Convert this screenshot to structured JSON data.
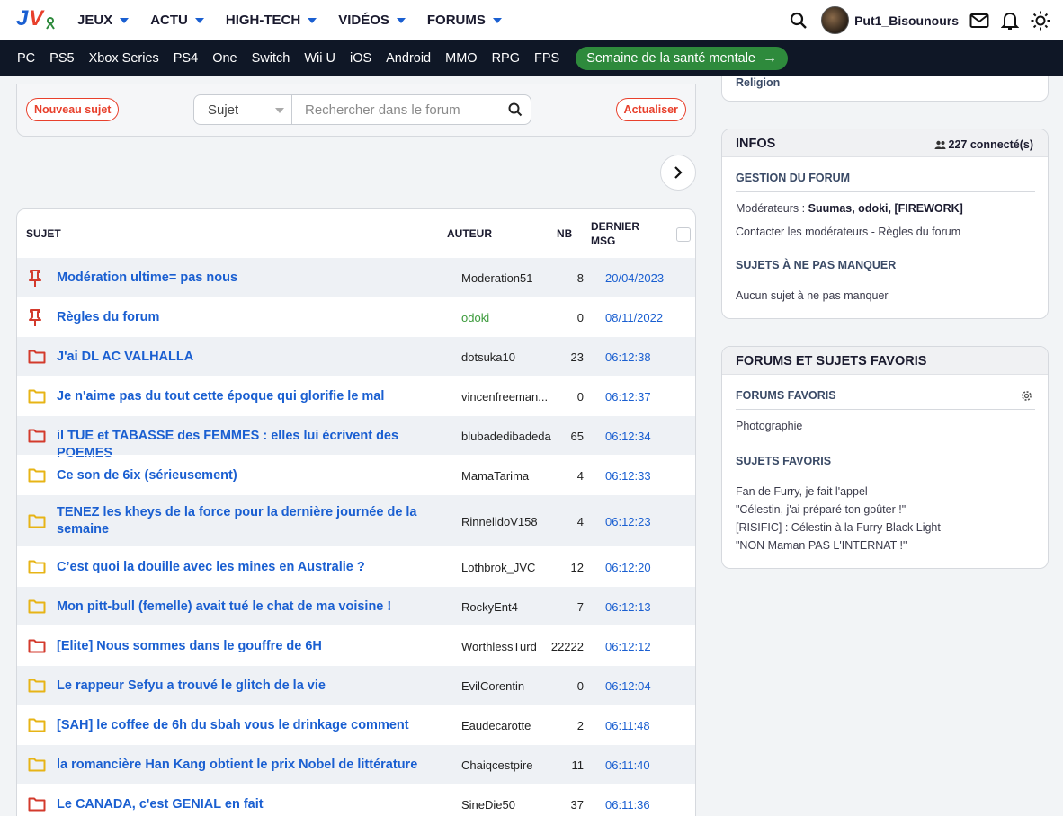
{
  "header": {
    "nav": [
      "JEUX",
      "ACTU",
      "HIGH-TECH",
      "VIDÉOS",
      "FORUMS"
    ],
    "username": "Put1_Bisounours"
  },
  "platforms": [
    "PC",
    "PS5",
    "Xbox Series",
    "PS4",
    "One",
    "Switch",
    "Wii U",
    "iOS",
    "Android",
    "MMO",
    "RPG",
    "FPS"
  ],
  "promo": "Semaine de la santé mentale",
  "search": {
    "new_topic": "Nouveau sujet",
    "select_value": "Sujet",
    "placeholder": "Rechercher dans le forum",
    "refresh": "Actualiser"
  },
  "table": {
    "col_subject": "SUJET",
    "col_author": "AUTEUR",
    "col_nb": "NB",
    "col_last_1": "DERNIER",
    "col_last_2": "MSG",
    "rows": [
      {
        "icon": "pin",
        "title": "Modération ultime= pas nous",
        "author": "Moderation51",
        "nb": "8",
        "last": "20/04/2023"
      },
      {
        "icon": "pin",
        "title": "Règles du forum",
        "author": "odoki",
        "nb": "0",
        "last": "08/11/2022"
      },
      {
        "icon": "folder-red",
        "title": "J'ai DL AC VALHALLA",
        "author": "dotsuka10",
        "nb": "23",
        "last": "06:12:38"
      },
      {
        "icon": "folder-yellow",
        "title": "Je n'aime pas du tout cette époque qui glorifie le mal",
        "author": "vincenfreeman...",
        "nb": "0",
        "last": "06:12:37"
      },
      {
        "icon": "folder-red",
        "title": "il TUE et TABASSE des FEMMES : elles lui écrivent des POEMES",
        "author": "blubadedibadeda",
        "nb": "65",
        "last": "06:12:34"
      },
      {
        "icon": "folder-yellow",
        "title": "Ce son de 6ix (sérieusement)",
        "author": "MamaTarima",
        "nb": "4",
        "last": "06:12:33"
      },
      {
        "icon": "folder-yellow",
        "title": "TENEZ les kheys de la force pour la dernière journée de la semaine",
        "author": "RinnelidoV158",
        "nb": "4",
        "last": "06:12:23"
      },
      {
        "icon": "folder-yellow",
        "title": "C’est quoi la douille avec les mines en Australie ?",
        "author": "Lothbrok_JVC",
        "nb": "12",
        "last": "06:12:20"
      },
      {
        "icon": "folder-yellow",
        "title": "Mon pitt-bull (femelle) avait tué le chat de ma voisine !",
        "author": "RockyEnt4",
        "nb": "7",
        "last": "06:12:13"
      },
      {
        "icon": "folder-red",
        "title": "[Elite] Nous sommes dans le gouffre de 6H",
        "author": "WorthlessTurd",
        "nb": "22222",
        "last": "06:12:12"
      },
      {
        "icon": "folder-yellow",
        "title": "Le rappeur Sefyu a trouvé le glitch de la vie",
        "author": "EvilCorentin",
        "nb": "0",
        "last": "06:12:04"
      },
      {
        "icon": "folder-yellow",
        "title": "[SAH] le coffee de 6h du sbah vous le drinkage comment",
        "author": "Eaudecarotte",
        "nb": "2",
        "last": "06:11:48"
      },
      {
        "icon": "folder-yellow",
        "title": "la romancière Han Kang obtient le prix Nobel de littérature",
        "author": "Chaiqcestpire",
        "nb": "11",
        "last": "06:11:40"
      },
      {
        "icon": "folder-red",
        "title": "Le CANADA, c'est GENIAL en fait",
        "author": "SineDie50",
        "nb": "37",
        "last": "06:11:36"
      }
    ]
  },
  "sidebar": {
    "top_item": "Religion",
    "infos": {
      "title": "INFOS",
      "connected": "227 connecté(s)",
      "gestion": "GESTION DU FORUM",
      "moderators_label": "Modérateurs :",
      "moderators": "Suumas, odoki, [FIREWORK]",
      "contact": "Contacter les modérateurs - Règles du forum",
      "must_see_title": "SUJETS À NE PAS MANQUER",
      "must_see_text": "Aucun sujet à ne pas manquer"
    },
    "favorites": {
      "title": "FORUMS ET SUJETS FAVORIS",
      "forums_title": "FORUMS FAVORIS",
      "forums": [
        "Photographie"
      ],
      "topics_title": "SUJETS FAVORIS",
      "topics": [
        "Fan de Furry, je fait l'appel",
        "\"Célestin, j'ai préparé ton goûter !\"",
        "[RISIFIC] : Célestin à la Furry Black Light",
        "\"NON Maman PAS L'INTERNAT !\""
      ]
    }
  },
  "colors": {
    "accent": "#1a5fd1",
    "danger": "#e8402c",
    "navbar": "#0f1726",
    "promo": "#2e8a3c",
    "folder_red": "#d33a2c",
    "folder_yellow": "#e7b416"
  }
}
